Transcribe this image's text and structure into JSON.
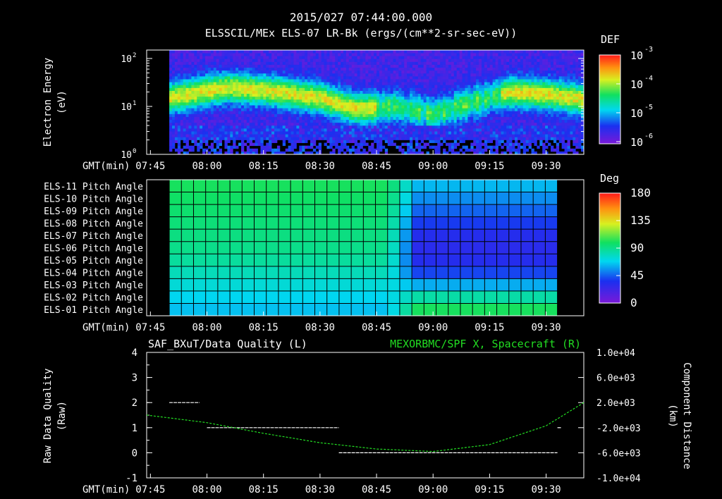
{
  "header": {
    "timestamp": "2015/027 07:44:00.000",
    "title": "ELSSCIL/MEx ELS-07 LR-Bk  (ergs/(cm**2-sr-sec-eV))"
  },
  "time_axis": {
    "label": "GMT(min)",
    "ticks": [
      "07:45",
      "08:00",
      "08:15",
      "08:30",
      "08:45",
      "09:00",
      "09:15",
      "09:30"
    ]
  },
  "chart_data": [
    {
      "type": "heatmap",
      "panel": "spectrogram",
      "ylabel": [
        "Electron Energy",
        "(eV)"
      ],
      "yscale": "log",
      "ylim": [
        1,
        150
      ],
      "ytick_labels": [
        "10",
        "10",
        "10"
      ],
      "ytick_exponents": [
        "2",
        "1",
        "0"
      ],
      "colorbar": {
        "label": "DEF",
        "scale": "log",
        "tick_labels": [
          "10",
          "10",
          "10",
          "10"
        ],
        "tick_exponents": [
          "-3",
          "-4",
          "-5",
          "-6"
        ]
      },
      "data_start": "07:50",
      "data_end": "09:40",
      "energy_band_peak": [
        {
          "time": "07:50",
          "peak_eV": 15
        },
        {
          "time": "08:05",
          "peak_eV": 25
        },
        {
          "time": "08:15",
          "peak_eV": 22
        },
        {
          "time": "08:30",
          "peak_eV": 15
        },
        {
          "time": "08:40",
          "peak_eV": 9
        },
        {
          "time": "08:50",
          "peak_eV": 10
        },
        {
          "time": "09:00",
          "peak_eV": 7
        },
        {
          "time": "09:20",
          "peak_eV": 20
        },
        {
          "time": "09:30",
          "peak_eV": 18
        },
        {
          "time": "09:40",
          "peak_eV": 14
        }
      ]
    },
    {
      "type": "heatmap",
      "panel": "pitch_angle",
      "rows": [
        "ELS-11 Pitch Angle",
        "ELS-10 Pitch Angle",
        "ELS-09 Pitch Angle",
        "ELS-08 Pitch Angle",
        "ELS-07 Pitch Angle",
        "ELS-06 Pitch Angle",
        "ELS-05 Pitch Angle",
        "ELS-04 Pitch Angle",
        "ELS-03 Pitch Angle",
        "ELS-02 Pitch Angle",
        "ELS-01 Pitch Angle"
      ],
      "data_start": "07:50",
      "data_end": "09:33",
      "colorbar": {
        "label": "Deg",
        "range": [
          0,
          180
        ],
        "tick_labels": [
          "180",
          "135",
          "90",
          "45",
          "0"
        ]
      },
      "values_deg": {
        "before_0852": [
          100,
          98,
          96,
          94,
          92,
          90,
          86,
          80,
          74,
          68,
          64
        ],
        "after_0852": [
          62,
          54,
          46,
          38,
          32,
          30,
          32,
          40,
          60,
          84,
          100
        ]
      }
    },
    {
      "type": "line",
      "panel": "data_quality",
      "left_series": "SAF_BXuT/Data Quality (L)",
      "right_series": "MEXORBMC/SPF X, Spacecraft (R)",
      "ylabel_left": [
        "Raw Data Quality",
        "(Raw)"
      ],
      "ylabel_right": [
        "Component Distance",
        "(km)"
      ],
      "ylim_left": [
        -1,
        4
      ],
      "yticks_left": [
        "4",
        "3",
        "2",
        "1",
        "0",
        "-1"
      ],
      "ylim_right": [
        -10000,
        10000
      ],
      "yticks_right": [
        "1.0e+04",
        "6.0e+03",
        "2.0e+03",
        "-2.0e+03",
        "-6.0e+03",
        "-1.0e+04"
      ],
      "series": [
        {
          "name": "SAF_BXuT/Data Quality (L)",
          "color": "#ffffff",
          "segments": [
            {
              "start": "07:50",
              "end": "07:58",
              "value": 2
            },
            {
              "start": "08:00",
              "end": "08:35",
              "value": 1
            },
            {
              "start": "08:35",
              "end": "09:33",
              "value": 0
            },
            {
              "start": "09:33",
              "end": "09:34",
              "value": 1
            }
          ]
        },
        {
          "name": "MEXORBMC/SPF X, Spacecraft (R)",
          "color": "#22dd22",
          "points": [
            {
              "t": "07:44",
              "km": 10
            },
            {
              "t": "08:00",
              "km": -1200
            },
            {
              "t": "08:15",
              "km": -2900
            },
            {
              "t": "08:30",
              "km": -4400
            },
            {
              "t": "08:45",
              "km": -5400
            },
            {
              "t": "09:00",
              "km": -5800
            },
            {
              "t": "09:15",
              "km": -4700
            },
            {
              "t": "09:30",
              "km": -1700
            },
            {
              "t": "09:40",
              "km": 2000
            }
          ]
        }
      ]
    }
  ]
}
